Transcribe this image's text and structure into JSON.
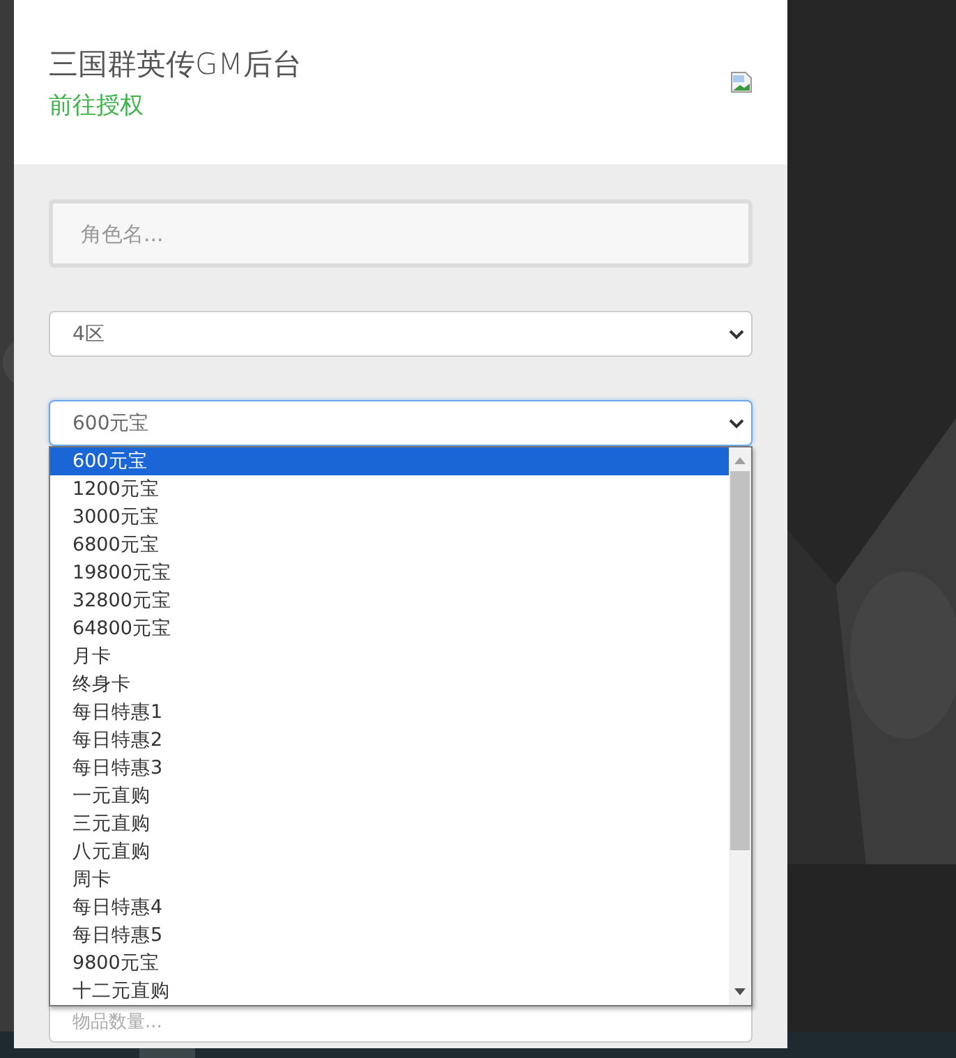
{
  "header": {
    "title": "三国群英传GM后台",
    "link": "前往授权"
  },
  "form": {
    "role_name": {
      "placeholder": "角色名..."
    },
    "server_select": {
      "value": "4区"
    },
    "item_select": {
      "value": "600元宝",
      "expanded": true,
      "options": [
        {
          "label": "600元宝",
          "selected": true
        },
        {
          "label": "1200元宝",
          "selected": false
        },
        {
          "label": "3000元宝",
          "selected": false
        },
        {
          "label": "6800元宝",
          "selected": false
        },
        {
          "label": "19800元宝",
          "selected": false
        },
        {
          "label": "32800元宝",
          "selected": false
        },
        {
          "label": "64800元宝",
          "selected": false
        },
        {
          "label": "月卡",
          "selected": false
        },
        {
          "label": "终身卡",
          "selected": false
        },
        {
          "label": "每日特惠1",
          "selected": false
        },
        {
          "label": "每日特惠2",
          "selected": false
        },
        {
          "label": "每日特惠3",
          "selected": false
        },
        {
          "label": "一元直购",
          "selected": false
        },
        {
          "label": "三元直购",
          "selected": false
        },
        {
          "label": "八元直购",
          "selected": false
        },
        {
          "label": "周卡",
          "selected": false
        },
        {
          "label": "每日特惠4",
          "selected": false
        },
        {
          "label": "每日特惠5",
          "selected": false
        },
        {
          "label": "9800元宝",
          "selected": false
        },
        {
          "label": "十二元直购",
          "selected": false
        }
      ]
    },
    "quantity": {
      "placeholder": "物品数量..."
    }
  }
}
